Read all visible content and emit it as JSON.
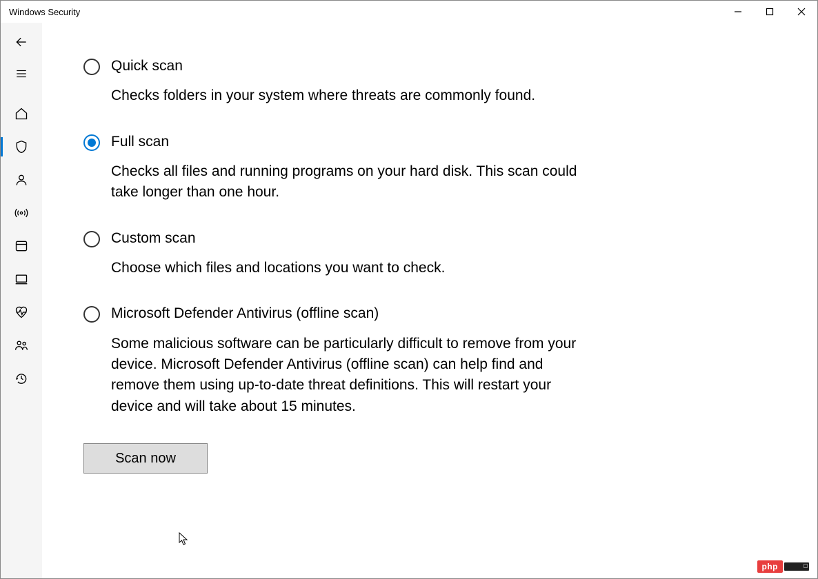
{
  "window": {
    "title": "Windows Security"
  },
  "selected_option": "full",
  "options": {
    "quick": {
      "title": "Quick scan",
      "desc": "Checks folders in your system where threats are commonly found."
    },
    "full": {
      "title": "Full scan",
      "desc": "Checks all files and running programs on your hard disk. This scan could take longer than one hour."
    },
    "custom": {
      "title": "Custom scan",
      "desc": "Choose which files and locations you want to check."
    },
    "offline": {
      "title": "Microsoft Defender Antivirus (offline scan)",
      "desc": "Some malicious software can be particularly difficult to remove from your device. Microsoft Defender Antivirus (offline scan) can help find and remove them using up-to-date threat definitions. This will restart your device and will take about 15 minutes."
    }
  },
  "buttons": {
    "scan_now": "Scan now"
  },
  "sidebar": {
    "items": [
      {
        "id": "back",
        "icon": "back-icon"
      },
      {
        "id": "menu",
        "icon": "menu-icon"
      },
      {
        "id": "home",
        "icon": "home-icon"
      },
      {
        "id": "shield",
        "icon": "shield-icon",
        "active": true
      },
      {
        "id": "account",
        "icon": "account-icon"
      },
      {
        "id": "network",
        "icon": "network-icon"
      },
      {
        "id": "app",
        "icon": "app-icon"
      },
      {
        "id": "device",
        "icon": "device-icon"
      },
      {
        "id": "health",
        "icon": "health-icon"
      },
      {
        "id": "family",
        "icon": "family-icon"
      },
      {
        "id": "history",
        "icon": "history-icon"
      }
    ]
  },
  "badge": {
    "text": "php"
  },
  "colors": {
    "accent": "#0078d4"
  }
}
